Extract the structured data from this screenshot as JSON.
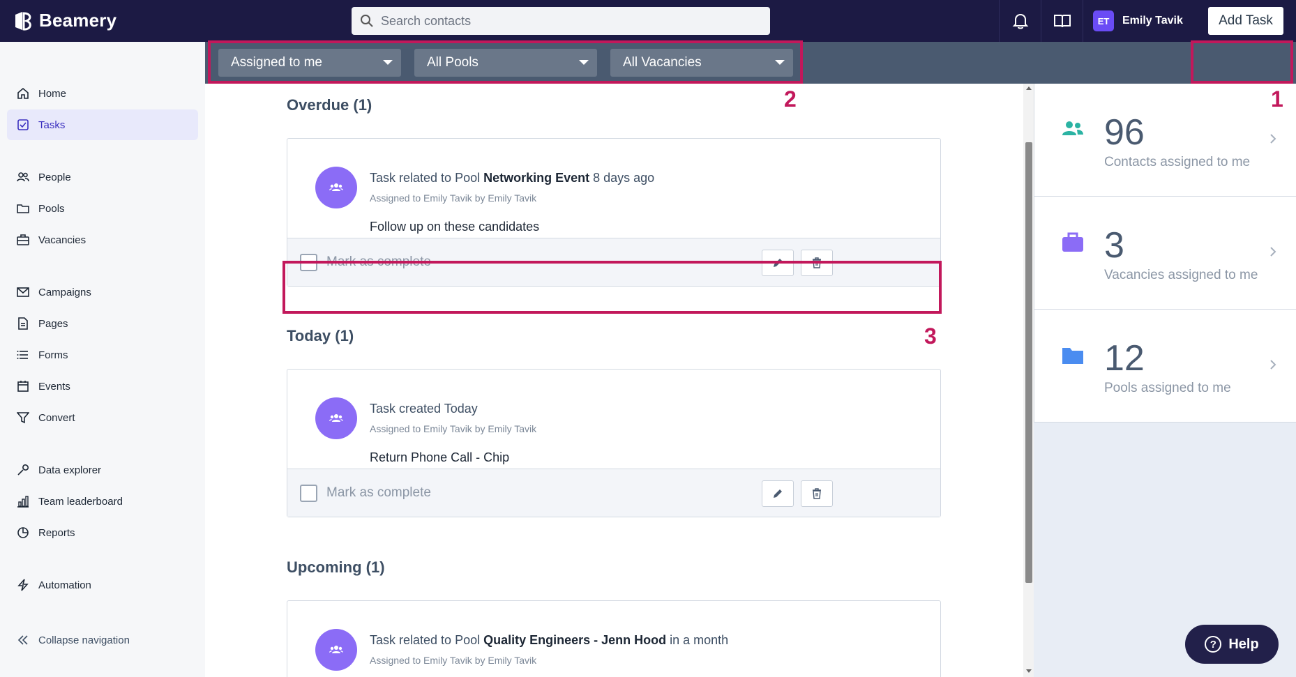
{
  "app": {
    "name": "Beamery"
  },
  "search": {
    "placeholder": "Search contacts"
  },
  "user": {
    "initials": "ET",
    "name": "Emily Tavik"
  },
  "sidebar": {
    "items": [
      {
        "label": "Home",
        "icon": "home-icon"
      },
      {
        "label": "Tasks",
        "icon": "tasks-icon",
        "active": true
      },
      {
        "label": "People",
        "icon": "people-icon"
      },
      {
        "label": "Pools",
        "icon": "folder-icon"
      },
      {
        "label": "Vacancies",
        "icon": "briefcase-icon"
      },
      {
        "label": "Campaigns",
        "icon": "mail-icon"
      },
      {
        "label": "Pages",
        "icon": "page-icon"
      },
      {
        "label": "Forms",
        "icon": "list-icon"
      },
      {
        "label": "Events",
        "icon": "calendar-icon"
      },
      {
        "label": "Convert",
        "icon": "funnel-icon"
      },
      {
        "label": "Data explorer",
        "icon": "wrench-icon"
      },
      {
        "label": "Team leaderboard",
        "icon": "bar-chart-icon"
      },
      {
        "label": "Reports",
        "icon": "pie-chart-icon"
      },
      {
        "label": "Automation",
        "icon": "bolt-icon"
      }
    ],
    "collapse_label": "Collapse navigation"
  },
  "filters": {
    "assigned": "Assigned to me",
    "pools": "All Pools",
    "vacancies": "All Vacancies",
    "add_task": "Add Task"
  },
  "annotations": {
    "one": "1",
    "two": "2",
    "three": "3"
  },
  "sections": {
    "overdue": {
      "title": "Overdue (1)",
      "task": {
        "prefix": "Task related to Pool ",
        "entity": "Networking Event",
        "suffix": " 8 days ago",
        "assigned": "Assigned to Emily Tavik by Emily Tavik",
        "note": "Follow up on these candidates",
        "mark_label": "Mark as complete"
      }
    },
    "today": {
      "title": "Today (1)",
      "task": {
        "line": "Task created Today",
        "assigned": "Assigned to Emily Tavik by Emily Tavik",
        "note": "Return Phone Call - Chip",
        "mark_label": "Mark as complete"
      }
    },
    "upcoming": {
      "title": "Upcoming (1)",
      "task": {
        "prefix": "Task related to Pool ",
        "entity": "Quality Engineers - Jenn Hood",
        "suffix": " in a month",
        "assigned": "Assigned to Emily Tavik by Emily Tavik"
      }
    }
  },
  "stats": [
    {
      "value": "96",
      "label": "Contacts assigned to me",
      "icon": "people-icon",
      "color": "#2bb3a3"
    },
    {
      "value": "3",
      "label": "Vacancies assigned to me",
      "icon": "briefcase-icon",
      "color": "#8b6cf6"
    },
    {
      "value": "12",
      "label": "Pools assigned to me",
      "icon": "folder-icon",
      "color": "#4a8cf0"
    }
  ],
  "help": {
    "label": "Help"
  },
  "colors": {
    "topbar": "#1c1a44",
    "filterbar": "#4a5a70",
    "accent": "#6a4cf5",
    "annotation": "#c2185b"
  }
}
